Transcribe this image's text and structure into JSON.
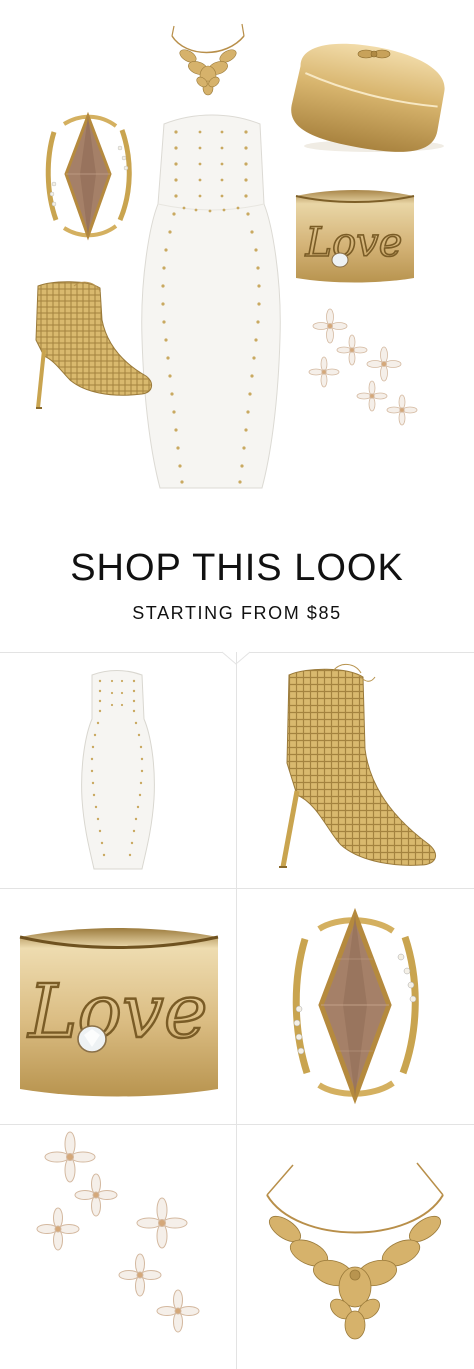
{
  "shop": {
    "title": "SHOP THIS LOOK",
    "subtitle": "STARTING FROM $85"
  },
  "products": [
    {
      "name": "white-strapless-dress",
      "icon": "dress-icon"
    },
    {
      "name": "gold-woven-bootie",
      "icon": "bootie-icon"
    },
    {
      "name": "love-cuff",
      "icon": "cuff-icon",
      "engraving": "Love"
    },
    {
      "name": "marquise-cocktail-ring",
      "icon": "ring-icon"
    },
    {
      "name": "flower-cluster-earrings",
      "icon": "earrings-icon"
    },
    {
      "name": "gold-leaf-necklace",
      "icon": "necklace-icon"
    }
  ],
  "collage": {
    "cuff_engraving": "Love"
  },
  "colors": {
    "gold": "#c9a961",
    "gold_light": "#e8d3a0",
    "gold_dark": "#9a7a3a",
    "stone": "#a07a62",
    "dress": "#f6f5f2",
    "divider": "#e3e3e3"
  }
}
